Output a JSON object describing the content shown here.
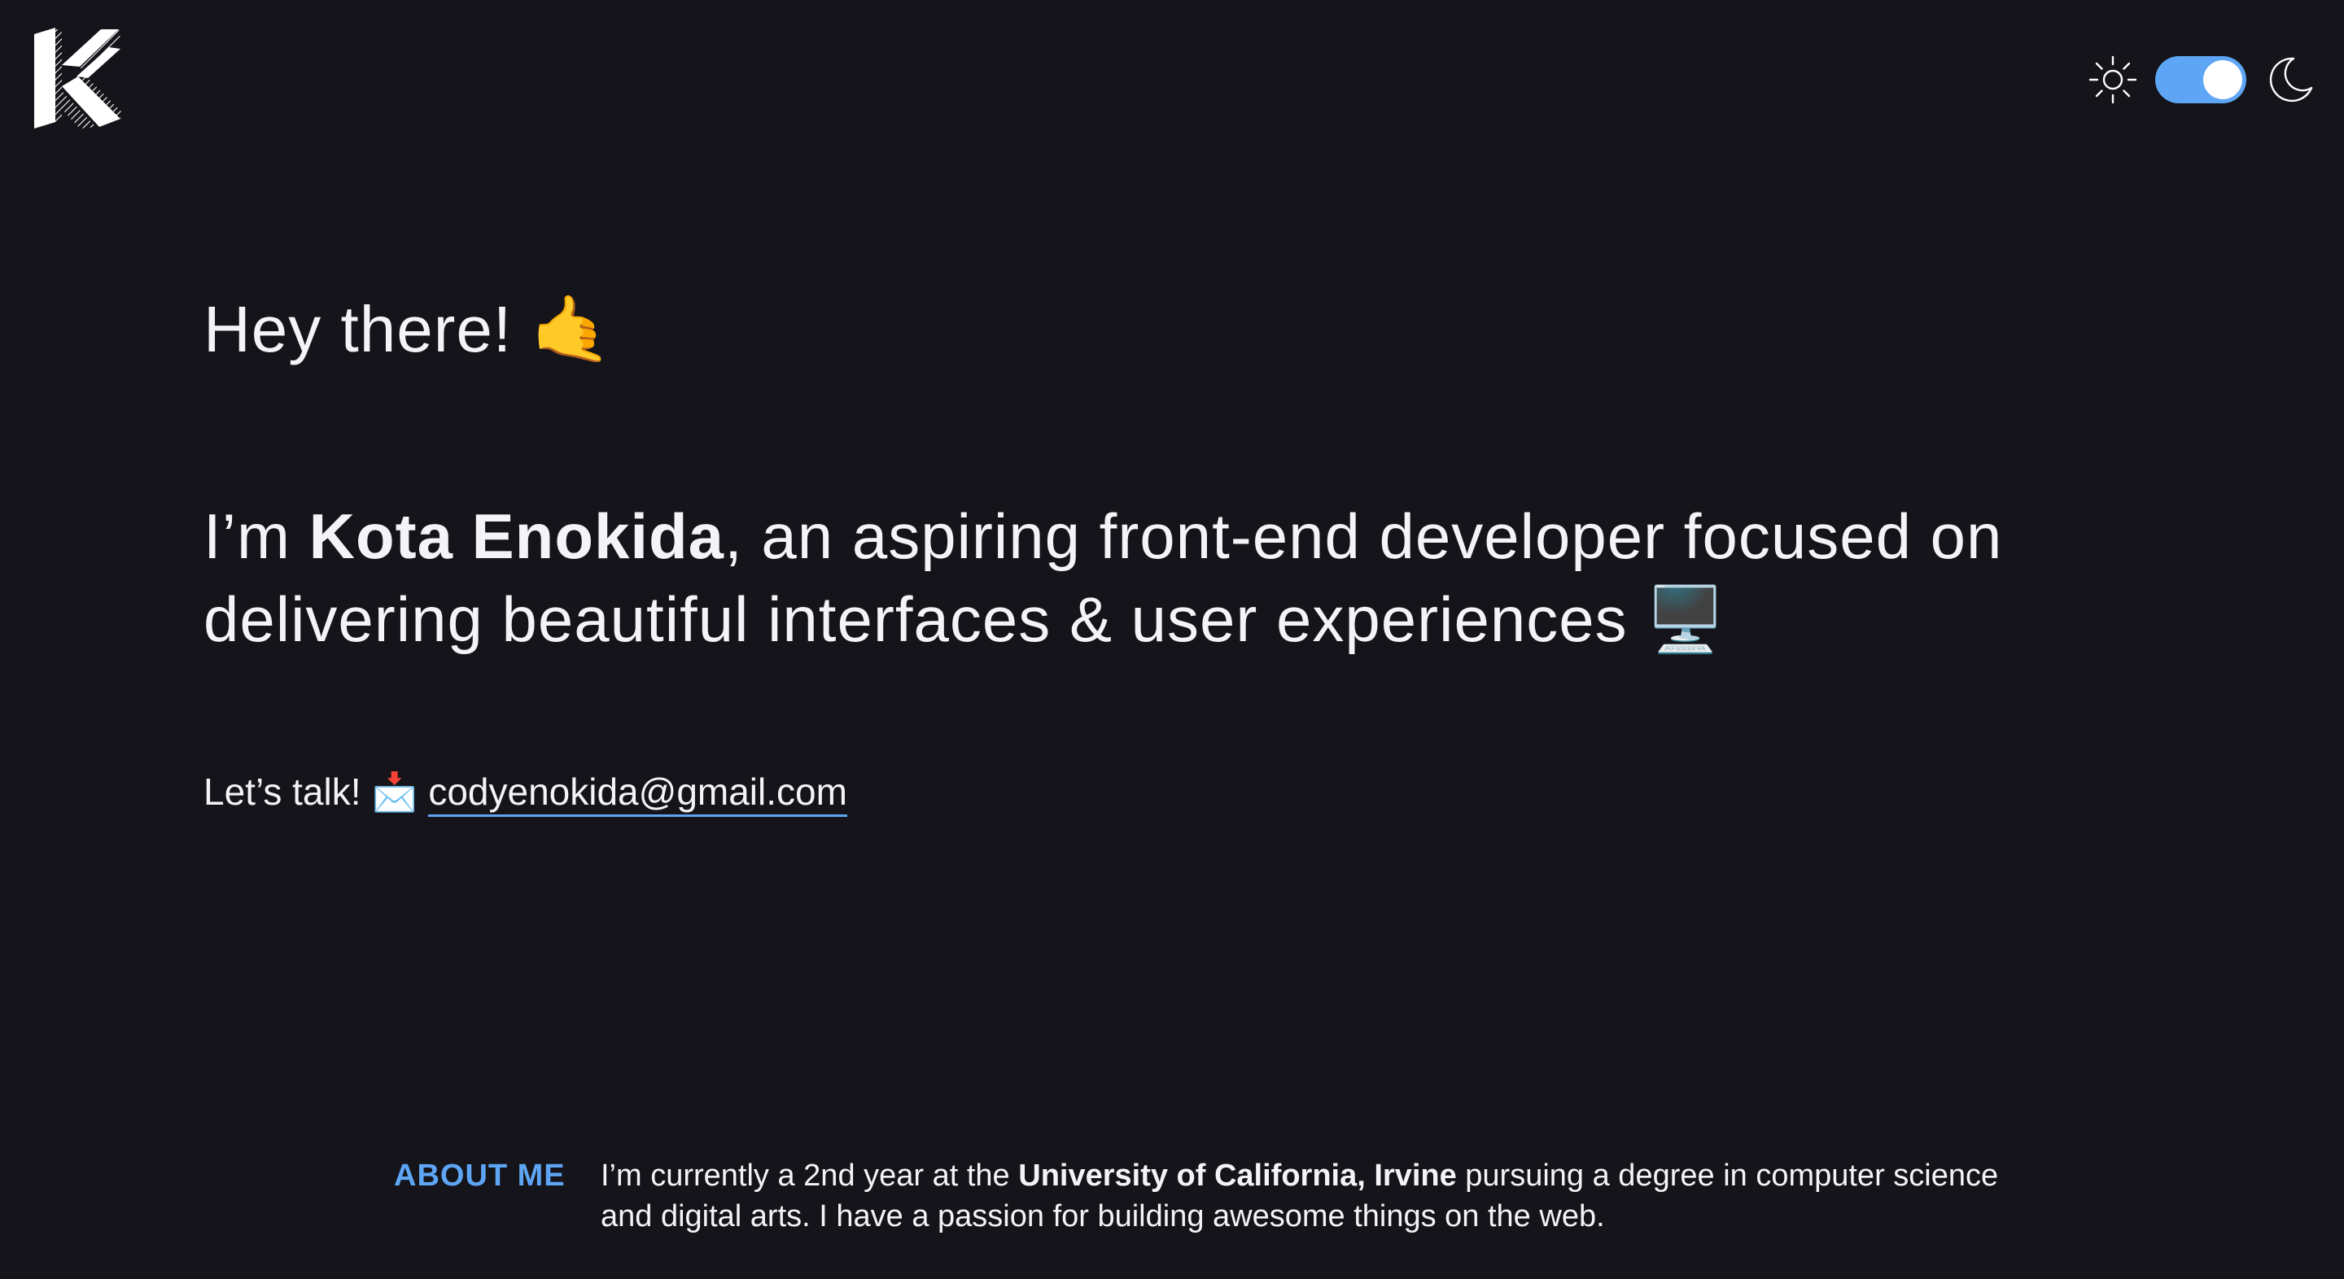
{
  "header": {
    "logo_icon": "kk-monogram-logo-icon",
    "theme_toggle": {
      "light_icon": "sun-icon",
      "dark_icon": "moon-icon",
      "state": "dark",
      "accent_color": "#5ea6f5"
    }
  },
  "hero": {
    "greeting": "Hey there!",
    "greeting_emoji": "🤙",
    "intro_prefix": "I’m ",
    "intro_name": "Kota Enokida",
    "intro_suffix": ", an aspiring front-end developer focused on delivering beautiful interfaces & user experiences",
    "intro_emoji": "🖥️",
    "contact_prefix": "Let’s talk!",
    "contact_emoji": "📩",
    "email": "codyenokida@gmail.com"
  },
  "about": {
    "label": "ABOUT ME",
    "text_prefix": "I’m currently a 2nd year at the ",
    "university": "University of California, Irvine",
    "text_suffix": " pursuing a degree in computer science and digital arts. I have a passion for building awesome things on the web."
  },
  "colors": {
    "background": "#14141a",
    "text": "#f4f4f6",
    "accent": "#5ea6f5"
  }
}
